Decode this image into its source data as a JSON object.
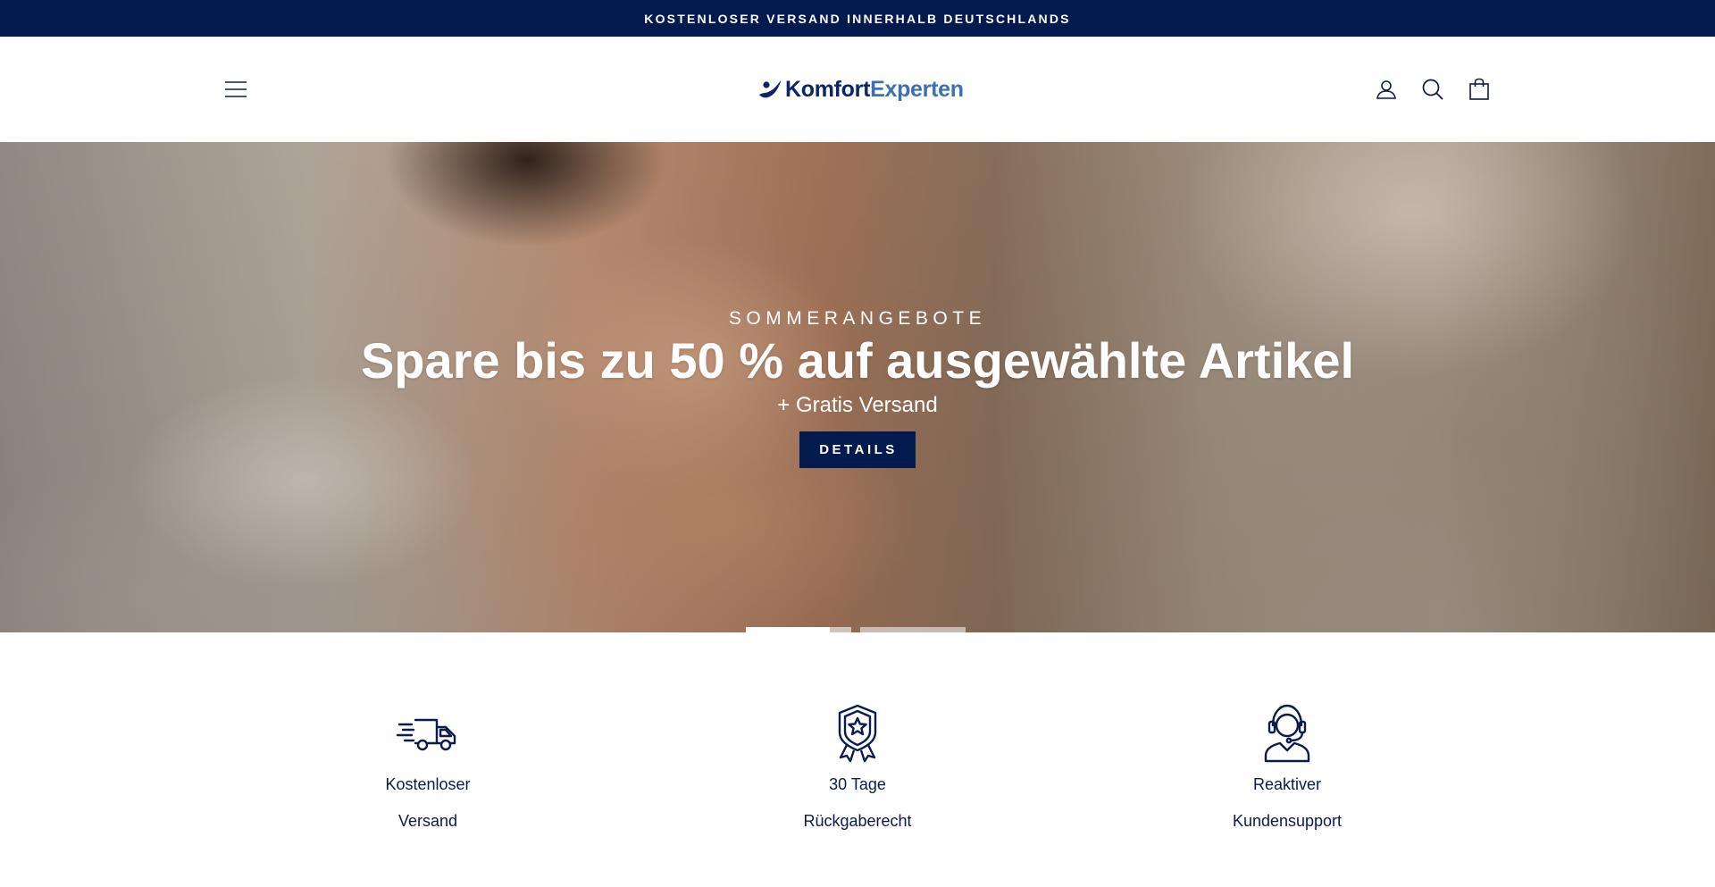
{
  "announcement": {
    "text": "KOSTENLOSER VERSAND INNERHALB DEUTSCHLANDS"
  },
  "header": {
    "logo": {
      "part1": "Komfort",
      "part2": "Experten"
    },
    "icons": [
      "hamburger-menu-icon",
      "account-icon",
      "search-icon",
      "cart-icon"
    ]
  },
  "hero": {
    "eyebrow": "SOMMERANGEBOTE",
    "title": "Spare bis zu 50 % auf ausgewählte Artikel",
    "subtitle": "+ Gratis Versand",
    "button_label": "DETAILS",
    "slides_count": 2,
    "active_slide": 1,
    "active_slide_progress": 0.8
  },
  "features": [
    {
      "icon": "delivery-truck-icon",
      "line1": "Kostenloser",
      "line2": "Versand"
    },
    {
      "icon": "award-badge-icon",
      "line1": "30 Tage",
      "line2": "Rückgaberecht"
    },
    {
      "icon": "customer-support-headset-icon",
      "line1": "Reaktiver",
      "line2": "Kundensupport"
    }
  ],
  "colors": {
    "navy": "#031a4f",
    "text": "#0b1b4d",
    "logo_light": "#3d6fb3",
    "white": "#ffffff"
  }
}
